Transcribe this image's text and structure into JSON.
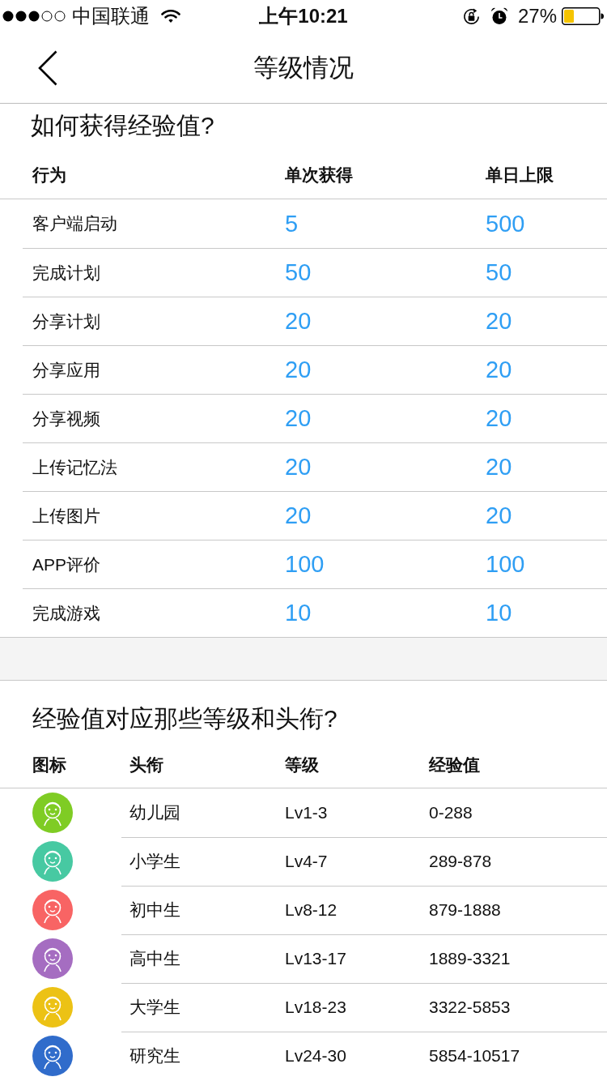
{
  "status_bar": {
    "carrier": "中国联通",
    "time": "上午10:21",
    "battery": "27%"
  },
  "nav": {
    "title": "等级情况"
  },
  "experience_rules": {
    "title": "如何获得经验值?",
    "columns": [
      "行为",
      "单次获得",
      "单日上限"
    ],
    "rows": [
      {
        "action": "客户端启动",
        "per_time": "5",
        "daily_limit": "500"
      },
      {
        "action": "完成计划",
        "per_time": "50",
        "daily_limit": "50"
      },
      {
        "action": "分享计划",
        "per_time": "20",
        "daily_limit": "20"
      },
      {
        "action": "分享应用",
        "per_time": "20",
        "daily_limit": "20"
      },
      {
        "action": "分享视频",
        "per_time": "20",
        "daily_limit": "20"
      },
      {
        "action": "上传记忆法",
        "per_time": "20",
        "daily_limit": "20"
      },
      {
        "action": "上传图片",
        "per_time": "20",
        "daily_limit": "20"
      },
      {
        "action": "APP评价",
        "per_time": "100",
        "daily_limit": "100"
      },
      {
        "action": "完成游戏",
        "per_time": "10",
        "daily_limit": "10"
      }
    ]
  },
  "levels": {
    "title": "经验值对应那些等级和头衔?",
    "columns": [
      "图标",
      "头衔",
      "等级",
      "经验值"
    ],
    "rows": [
      {
        "color": "#7fcc24",
        "title": "幼儿园",
        "level": "Lv1-3",
        "experience": "0-288"
      },
      {
        "color": "#47c9a2",
        "title": "小学生",
        "level": "Lv4-7",
        "experience": "289-878"
      },
      {
        "color": "#f86464",
        "title": "初中生",
        "level": "Lv8-12",
        "experience": "879-1888"
      },
      {
        "color": "#a56dc1",
        "title": "高中生",
        "level": "Lv13-17",
        "experience": "1889-3321"
      },
      {
        "color": "#ecc215",
        "title": "大学生",
        "level": "Lv18-23",
        "experience": "3322-5853"
      },
      {
        "color": "#306ccb",
        "title": "研究生",
        "level": "Lv24-30",
        "experience": "5854-10517"
      }
    ]
  }
}
